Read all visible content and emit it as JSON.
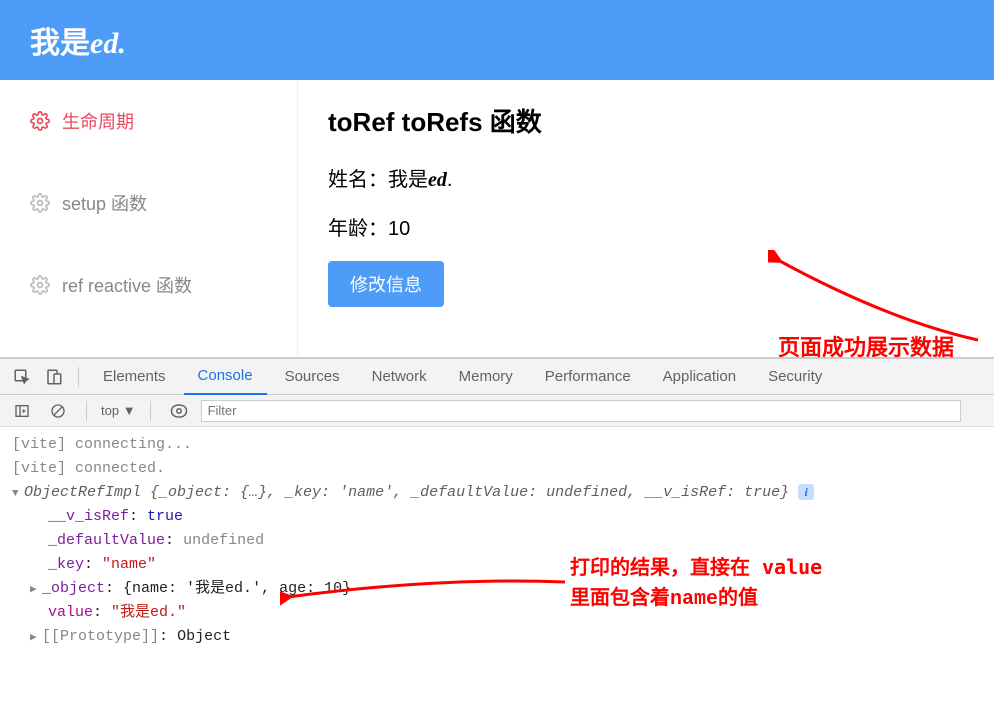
{
  "header": {
    "title_pre": "我是",
    "title_ital": "ed."
  },
  "sidebar": {
    "items": [
      {
        "label": "生命周期",
        "active": true
      },
      {
        "label": "setup 函数",
        "active": false
      },
      {
        "label": "ref reactive 函数",
        "active": false
      }
    ]
  },
  "main": {
    "heading": "toRef toRefs 函数",
    "name_label": "姓名：",
    "name_pre": "我是",
    "name_ital": "ed",
    "name_post": ".",
    "age_label": "年龄：",
    "age_value": "10",
    "button": "修改信息"
  },
  "annotations": {
    "a1": "页面成功展示数据",
    "a2_l1_pre": "打印的结果，直接在 ",
    "a2_l1_code": "value",
    "a2_l2": "里面包含着name的值"
  },
  "devtools": {
    "tabs": [
      "Elements",
      "Console",
      "Sources",
      "Network",
      "Memory",
      "Performance",
      "Application",
      "Security"
    ],
    "active_tab": "Console",
    "context": "top",
    "filter_placeholder": "Filter"
  },
  "console": {
    "l1": "[vite] connecting...",
    "l2": "[vite] connected.",
    "summary_class": "ObjectRefImpl",
    "summary_rest": " {_object: {…}, _key: 'name', _defaultValue: undefined, __v_isRef: true}",
    "p_isRef_k": "__v_isRef",
    "p_isRef_v": "true",
    "p_default_k": "_defaultValue",
    "p_default_v": "undefined",
    "p_key_k": "_key",
    "p_key_v": "\"name\"",
    "p_obj_k": "_object",
    "p_obj_v": "{name: '我是ed.', age: 10}",
    "p_value_k": "value",
    "p_value_v": "\"我是ed.\"",
    "p_proto_k": "[[Prototype]]",
    "p_proto_v": "Object"
  }
}
